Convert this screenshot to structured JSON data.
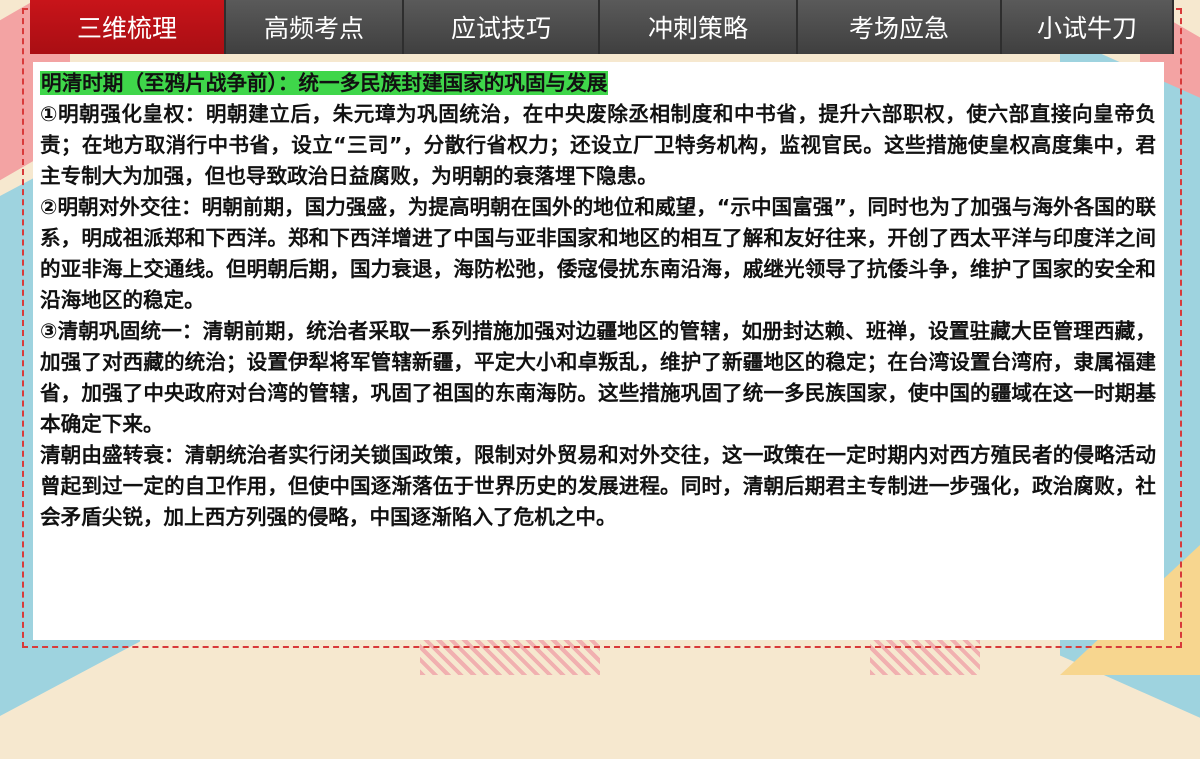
{
  "tabs": [
    {
      "label": "三维梳理",
      "active": true
    },
    {
      "label": "高频考点",
      "active": false
    },
    {
      "label": "应试技巧",
      "active": false
    },
    {
      "label": "冲刺策略",
      "active": false
    },
    {
      "label": "考场应急",
      "active": false
    },
    {
      "label": "小试牛刀",
      "active": false
    }
  ],
  "content": {
    "heading": "明清时期（至鸦片战争前）：统一多民族封建国家的巩固与发展",
    "paragraphs": [
      "①明朝强化皇权：明朝建立后，朱元璋为巩固统治，在中央废除丞相制度和中书省，提升六部职权，使六部直接向皇帝负责；在地方取消行中书省，设立“三司”，分散行省权力；还设立厂卫特务机构，监视官民。这些措施使皇权高度集中，君主专制大为加强，但也导致政治日益腐败，为明朝的衰落埋下隐患。",
      "②明朝对外交往：明朝前期，国力强盛，为提高明朝在国外的地位和威望，“示中国富强”，同时也为了加强与海外各国的联系，明成祖派郑和下西洋。郑和下西洋增进了中国与亚非国家和地区的相互了解和友好往来，开创了西太平洋与印度洋之间的亚非海上交通线。但明朝后期，国力衰退，海防松弛，倭寇侵扰东南沿海，戚继光领导了抗倭斗争，维护了国家的安全和沿海地区的稳定。",
      "③清朝巩固统一：清朝前期，统治者采取一系列措施加强对边疆地区的管辖，如册封达赖、班禅，设置驻藏大臣管理西藏，加强了对西藏的统治；设置伊犁将军管辖新疆，平定大小和卓叛乱，维护了新疆地区的稳定；在台湾设置台湾府，隶属福建省，加强了中央政府对台湾的管辖，巩固了祖国的东南海防。这些措施巩固了统一多民族国家，使中国的疆域在这一时期基本确定下来。",
      "清朝由盛转衰：清朝统治者实行闭关锁国政策，限制对外贸易和对外交往，这一政策在一定时期内对西方殖民者的侵略活动曾起到过一定的自卫作用，但使中国逐渐落伍于世界历史的发展进程。同时，清朝后期君主专制进一步强化，政治腐败，社会矛盾尖锐，加上西方列强的侵略，中国逐渐陷入了危机之中。"
    ]
  },
  "colors": {
    "active_tab": "#c8141a",
    "inactive_tab": "#4a4a4a",
    "heading_highlight": "#3fd64a",
    "frame": "#d83a3a"
  }
}
